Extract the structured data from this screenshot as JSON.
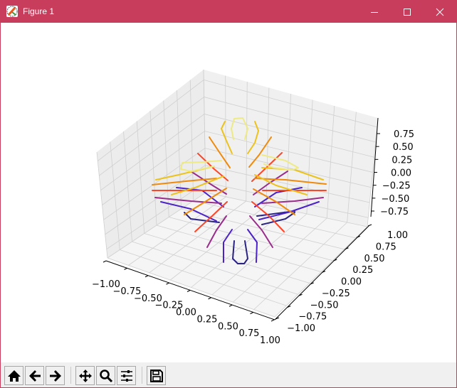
{
  "window": {
    "title": "Figure 1",
    "titlebar_color": "#c83c5c"
  },
  "toolbar": {
    "buttons": [
      {
        "name": "home-button",
        "icon": "home-icon"
      },
      {
        "name": "back-button",
        "icon": "arrow-left-icon"
      },
      {
        "name": "forward-button",
        "icon": "arrow-right-icon"
      },
      {
        "name": "pan-button",
        "icon": "move-icon"
      },
      {
        "name": "zoom-button",
        "icon": "magnifier-icon"
      },
      {
        "name": "configure-subplots-button",
        "icon": "sliders-icon"
      },
      {
        "name": "save-button",
        "icon": "floppy-icon"
      }
    ]
  },
  "chart_data": {
    "type": "contour3d",
    "title": "",
    "xlabel": "",
    "ylabel": "",
    "zlabel": "",
    "xlim": [
      -1,
      1
    ],
    "ylim": [
      -1,
      1
    ],
    "zlim": [
      -0.9,
      0.9
    ],
    "x_ticks": [
      "−1.00",
      "−0.75",
      "−0.50",
      "−0.25",
      "0.00",
      "0.25",
      "0.50",
      "0.75",
      "1.00"
    ],
    "y_ticks": [
      "−1.00",
      "−0.75",
      "−0.50",
      "−0.25",
      "0.00",
      "0.25",
      "0.50",
      "0.75",
      "1.00"
    ],
    "z_ticks": [
      "−0.75",
      "−0.50",
      "−0.25",
      "0.00",
      "0.25",
      "0.50",
      "0.75"
    ],
    "grid": true,
    "colormap": "plasma",
    "levels": [
      {
        "z": -0.75,
        "color": "#2a2383"
      },
      {
        "z": -0.5,
        "color": "#4b22c8"
      },
      {
        "z": -0.25,
        "color": "#9a2c8c"
      },
      {
        "z": 0.0,
        "color": "#ff4528"
      },
      {
        "z": 0.25,
        "color": "#ef8a0c"
      },
      {
        "z": 0.5,
        "color": "#ecc21c"
      },
      {
        "z": 0.75,
        "color": "#eeea86"
      }
    ]
  }
}
